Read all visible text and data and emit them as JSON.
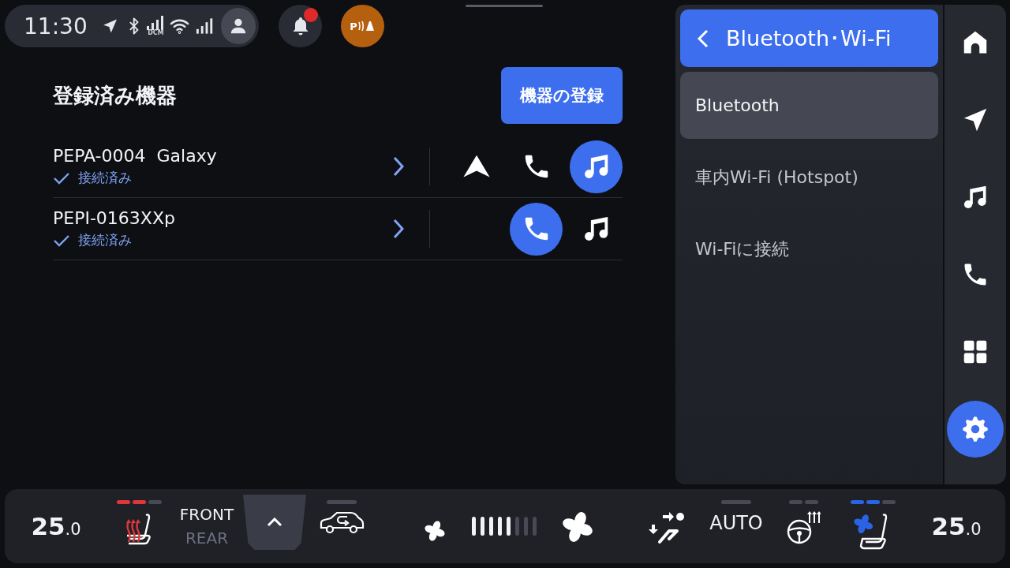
{
  "status_bar": {
    "time": "11:30",
    "signal_label": "DCM",
    "notification": {
      "has_badge": true
    },
    "parking_badge": {
      "label": "P"
    }
  },
  "devices_page": {
    "title": "登録済み機器",
    "register_button": "機器の登録",
    "devices": [
      {
        "name": "PEPA-0004  Galaxy",
        "status": "接続済み",
        "connected": true,
        "services": [
          {
            "kind": "android_auto",
            "active": false
          },
          {
            "kind": "phone",
            "active": false
          },
          {
            "kind": "music",
            "active": true
          }
        ]
      },
      {
        "name": "PEPI-0163XXp",
        "status": "接続済み",
        "connected": true,
        "services": [
          {
            "kind": "phone",
            "active": true
          },
          {
            "kind": "music",
            "active": false
          }
        ]
      }
    ]
  },
  "settings_menu": {
    "header": "Bluetooth･Wi-Fi",
    "items": [
      {
        "label": "Bluetooth",
        "selected": true
      },
      {
        "label": "車内Wi-Fi (Hotspot)",
        "selected": false
      },
      {
        "label": "Wi-Fiに接続",
        "selected": false
      }
    ]
  },
  "nav_rail": [
    {
      "kind": "home",
      "selected": false
    },
    {
      "kind": "navigation",
      "selected": false
    },
    {
      "kind": "music",
      "selected": false
    },
    {
      "kind": "phone",
      "selected": false
    },
    {
      "kind": "apps",
      "selected": false
    },
    {
      "kind": "settings",
      "selected": true
    }
  ],
  "climate": {
    "left_temp": {
      "whole": "25",
      "fraction": ".0"
    },
    "right_temp": {
      "whole": "25",
      "fraction": ".0"
    },
    "controls": [
      {
        "kind": "seat_heat",
        "level": 0.67
      },
      {
        "kind": "front_rear",
        "options": [
          {
            "label": "FRONT",
            "selected": true
          },
          {
            "label": "REAR",
            "selected": false
          }
        ]
      },
      {
        "kind": "expand"
      },
      {
        "kind": "recirculation",
        "on": false
      },
      {
        "kind": "fan_low"
      },
      {
        "kind": "fan_speed",
        "level": 0.625
      },
      {
        "kind": "fan_high"
      },
      {
        "kind": "airflow"
      },
      {
        "kind": "auto",
        "label": "AUTO",
        "on": false
      },
      {
        "kind": "steering_heat",
        "on": false
      },
      {
        "kind": "seat_vent",
        "level": 0.67
      }
    ]
  }
}
